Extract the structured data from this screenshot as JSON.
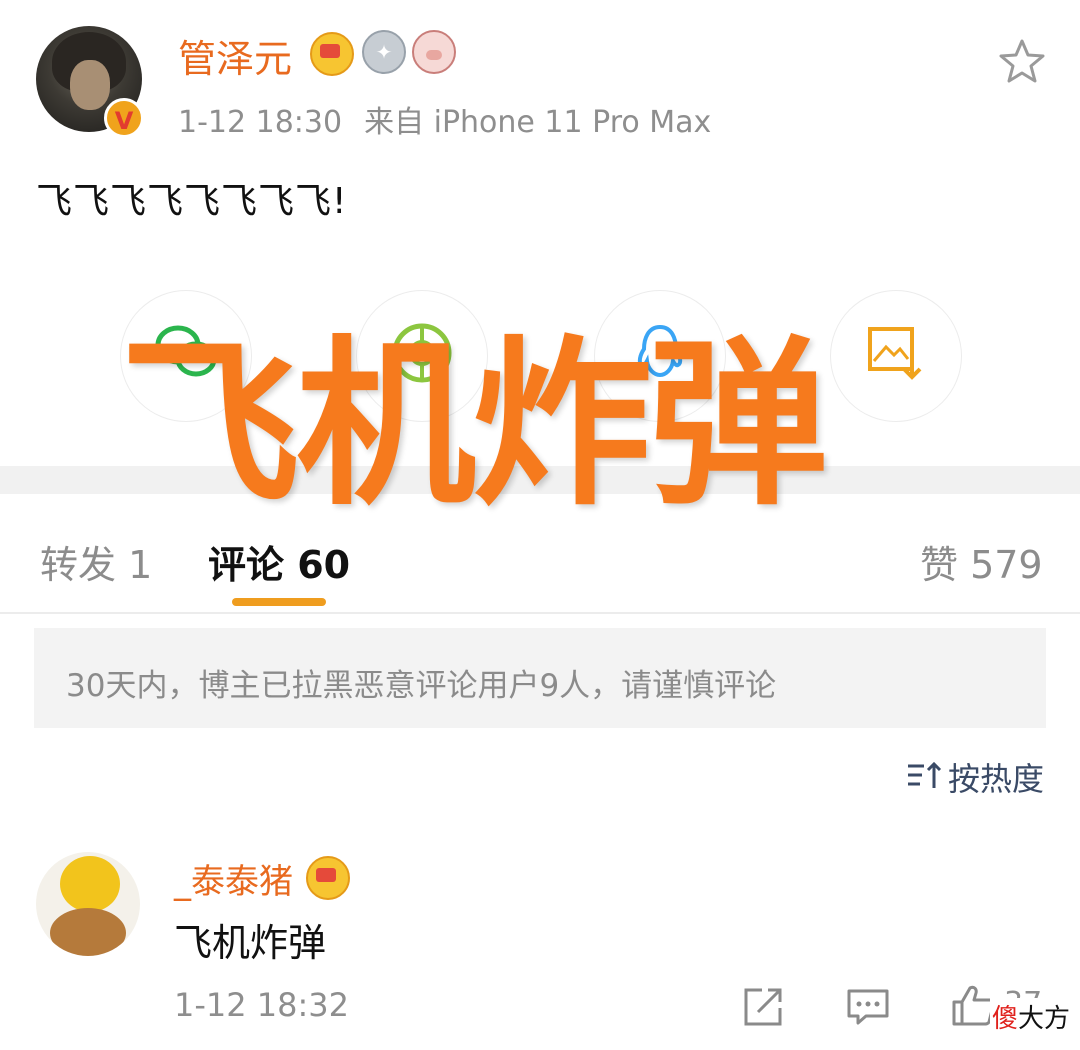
{
  "post": {
    "username": "管泽元",
    "time": "1-12 18:30",
    "source": "来自 iPhone 11 Pro Max",
    "text": "飞飞飞飞飞飞飞飞!",
    "verified_badge": "V"
  },
  "share": {
    "items": [
      {
        "icon": "wechat-icon",
        "color": "#2bb54d"
      },
      {
        "icon": "moments-icon",
        "color": "#8cc63f"
      },
      {
        "icon": "qq-icon",
        "color": "#3aa5f5"
      },
      {
        "icon": "save-image-icon",
        "color": "#f0a31c"
      }
    ]
  },
  "tabs": {
    "repost": "转发 1",
    "comments": "评论 60",
    "likes": "赞 579",
    "active": "comments",
    "accent": "#ef9d1f"
  },
  "notice": "30天内，博主已拉黑恶意评论用户9人，请谨慎评论",
  "sort": {
    "label": "按热度"
  },
  "comment": {
    "username": "_泰泰猪",
    "text": "飞机炸弹",
    "time": "1-12 18:32",
    "like_count": "37"
  },
  "overlay": {
    "title": "飞机炸弹",
    "color": "#f67a1d"
  },
  "watermark": {
    "red": "傻",
    "black": "大方"
  },
  "colors": {
    "username": "#e86a1f",
    "muted": "#8e8e8e",
    "sort": "#3a4a66"
  }
}
